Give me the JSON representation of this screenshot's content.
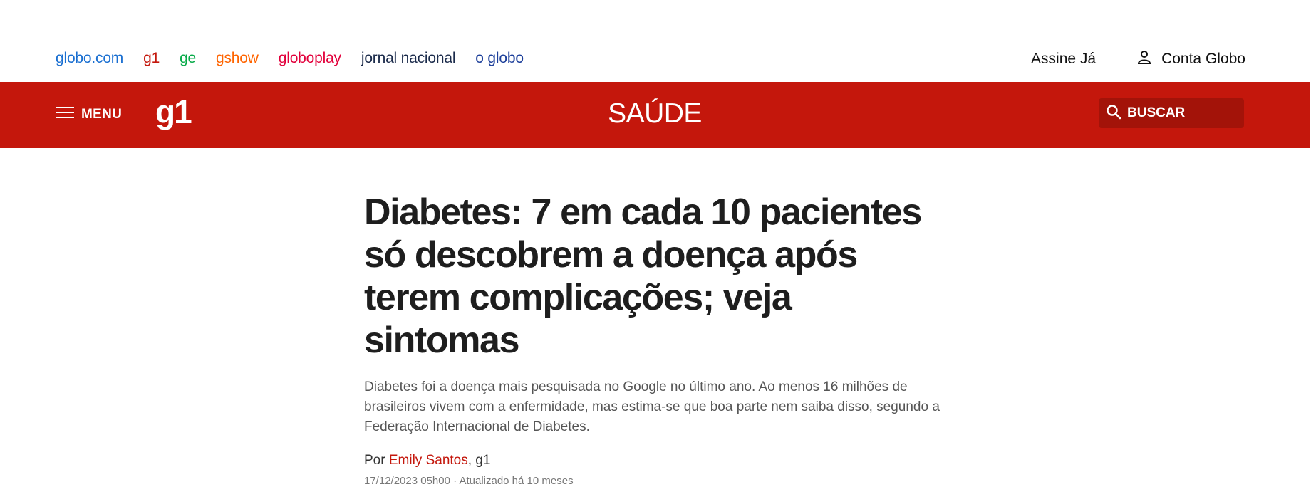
{
  "globo_nav": {
    "links": [
      {
        "label": "globo.com",
        "color": "#1a6fd1"
      },
      {
        "label": "g1",
        "color": "#c4170c"
      },
      {
        "label": "ge",
        "color": "#06aa48"
      },
      {
        "label": "gshow",
        "color": "#ff6400"
      },
      {
        "label": "globoplay",
        "color": "#e2003b"
      },
      {
        "label": "jornal nacional",
        "color": "#1b2b4b"
      },
      {
        "label": "o globo",
        "color": "#1d3f9a"
      }
    ],
    "subscribe": "Assine Já",
    "account": "Conta Globo",
    "account_icon": "user-icon"
  },
  "header": {
    "background": "#c4170c",
    "menu_label": "MENU",
    "menu_icon": "hamburger-icon",
    "logo": "g1",
    "section": "SAÚDE",
    "search_label": "BUSCAR",
    "search_icon": "search-icon"
  },
  "article": {
    "headline": "Diabetes: 7 em cada 10 pacientes só descobrem a doença após terem complicações; veja sintomas",
    "subtitle": "Diabetes foi a doença mais pesquisada no Google no último ano. Ao menos 16 milhões de brasileiros vivem com a enfermidade, mas estima-se que boa parte nem saiba disso, segundo a Federação Internacional de Diabetes.",
    "byline_prefix": "Por",
    "author": "Emily Santos",
    "outlet": ", g1",
    "date": "17/12/2023 05h00",
    "separator": " · ",
    "updated": "Atualizado há 10 meses"
  }
}
